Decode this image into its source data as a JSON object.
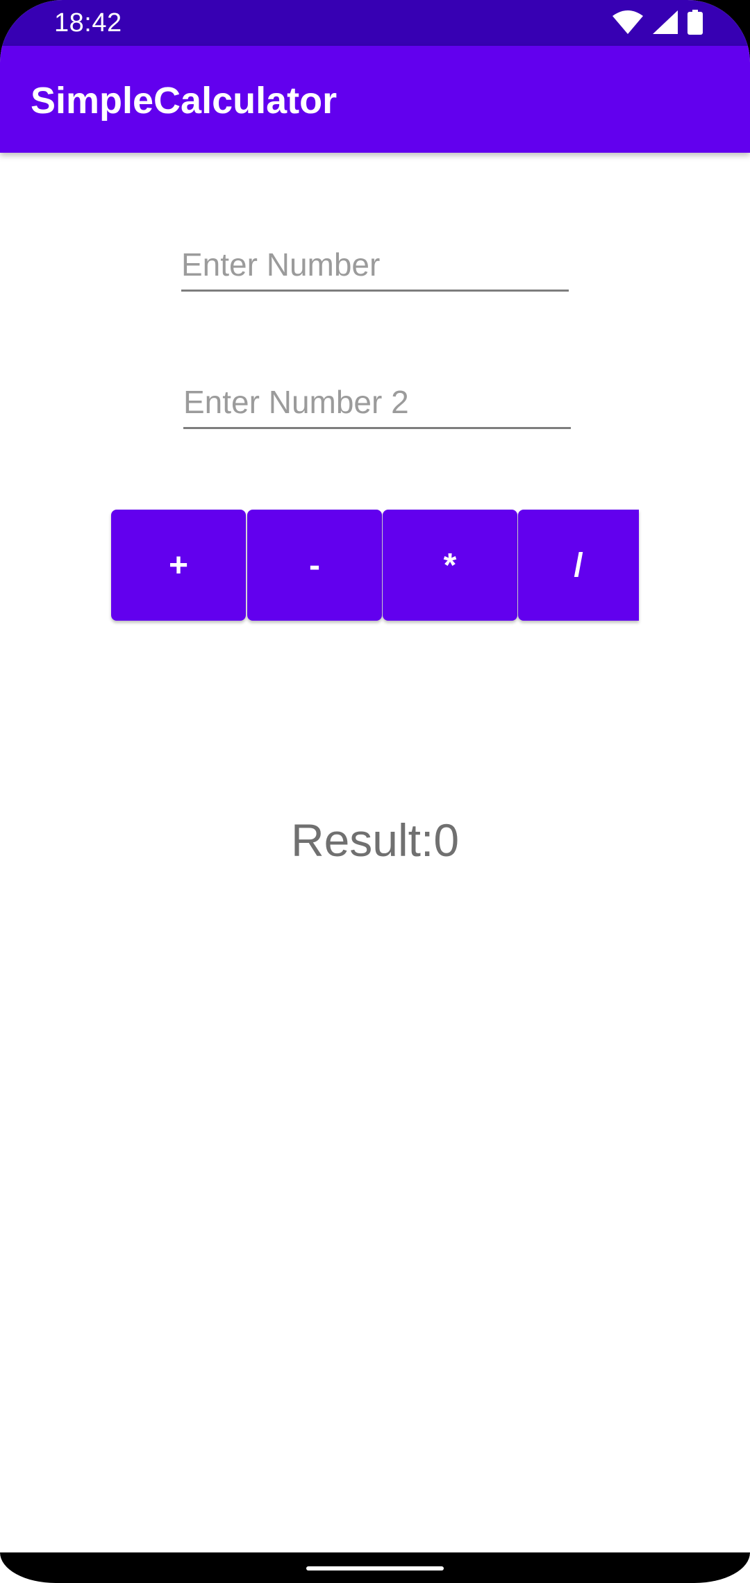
{
  "status_bar": {
    "time": "18:42",
    "icons": [
      "wifi-icon",
      "cell-signal-icon",
      "battery-icon"
    ]
  },
  "app_bar": {
    "title": "SimpleCalculator"
  },
  "inputs": {
    "number1": {
      "value": "",
      "placeholder": "Enter Number"
    },
    "number2": {
      "value": "",
      "placeholder": "Enter Number 2"
    }
  },
  "operations": {
    "add": "+",
    "subtract": "-",
    "multiply": "*",
    "divide": "/"
  },
  "result": {
    "text": "Result:0"
  },
  "colors": {
    "status_bar": "#3700b3",
    "primary": "#6200ee",
    "result_text": "#707070",
    "placeholder": "#9b9b9b"
  }
}
